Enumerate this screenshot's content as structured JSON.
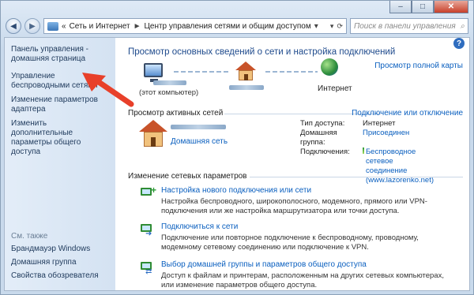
{
  "window": {
    "min": "–",
    "max": "□",
    "close": "✕"
  },
  "address": {
    "crumbs": [
      "Сеть и Интернет",
      "Центр управления сетями и общим доступом"
    ],
    "prefix": "«",
    "sep": "►",
    "search_placeholder": "Поиск в панели управления"
  },
  "sidebar": {
    "items": [
      "Панель управления - домашняя страница",
      "Управление беспроводными сетями",
      "Изменение параметров адаптера",
      "Изменить дополнительные параметры общего доступа"
    ],
    "see_also": "См. также",
    "bottom": [
      "Брандмауэр Windows",
      "Домашняя группа",
      "Свойства обозревателя"
    ]
  },
  "main": {
    "heading": "Просмотр основных сведений о сети и настройка подключений",
    "full_map": "Просмотр полной карты",
    "pc_label": "(этот компьютер)",
    "internet_label": "Интернет",
    "active_nets": "Просмотр активных сетей",
    "conn_toggle": "Подключение или отключение",
    "home_net": "Домашняя сеть",
    "props": [
      {
        "label": "Тип доступа:",
        "value": "Интернет"
      },
      {
        "label": "Домашняя группа:",
        "value": "Присоединен"
      },
      {
        "label": "Подключения:",
        "value": "Беспроводное сетевое соединение (www.lazorenko.net)"
      }
    ],
    "change_title": "Изменение сетевых параметров",
    "tasks": [
      {
        "link": "Настройка нового подключения или сети",
        "desc": "Настройка беспроводного, широкополосного, модемного, прямого или VPN-подключения или же настройка маршрутизатора или точки доступа."
      },
      {
        "link": "Подключиться к сети",
        "desc": "Подключение или повторное подключение к беспроводному, проводному, модемному сетевому соединению или подключение к VPN."
      },
      {
        "link": "Выбор домашней группы и параметров общего доступа",
        "desc": "Доступ к файлам и принтерам, расположенным на других сетевых компьютерах, или изменение параметров общего доступа."
      }
    ]
  },
  "colors": {
    "accent": "#0a5fbf",
    "arrow": "#e8402a"
  }
}
